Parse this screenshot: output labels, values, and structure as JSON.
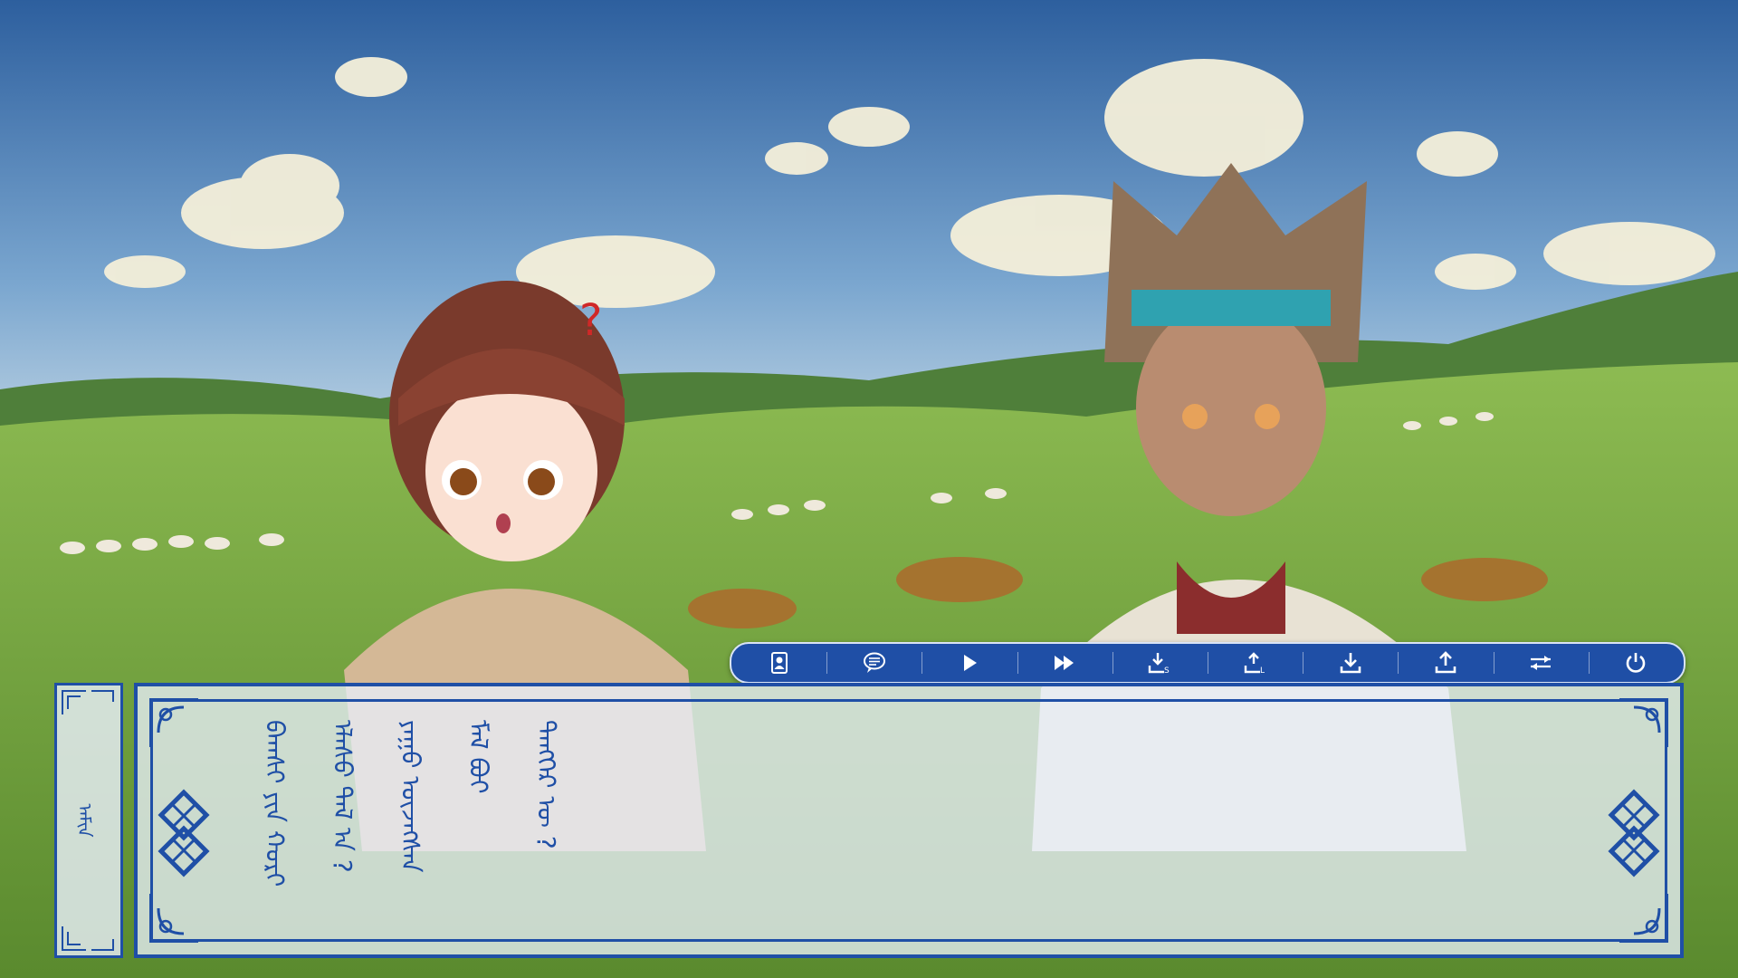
{
  "dialog": {
    "speaker": "ᠠᠮᠢᠨ",
    "lines": [
      "ᠪᠠᠭᠰᠢ ᠶᠢᠨ ᠬᠤᠷᠢ",
      "ᠡᠯᠡᠰᠦ ᠲᠠᠯ ᠠ ?",
      "ᠶᠠᠭᠤ ᠦᠵᠡᠭᠰᠡᠨ",
      "ᠮᠠᠯ ᠪᠣᠢ",
      "ᠲᠡᠩᠭᠡᠷ ᠦ ?"
    ]
  },
  "toolbar": {
    "buttons": [
      {
        "name": "profile-button",
        "icon": "profile-card-icon"
      },
      {
        "name": "log-button",
        "icon": "speech-bubble-icon"
      },
      {
        "name": "auto-play-button",
        "icon": "play-icon"
      },
      {
        "name": "skip-button",
        "icon": "fast-forward-icon"
      },
      {
        "name": "quick-save-button",
        "icon": "quick-save-icon"
      },
      {
        "name": "quick-load-button",
        "icon": "quick-load-icon"
      },
      {
        "name": "save-button",
        "icon": "download-icon"
      },
      {
        "name": "load-button",
        "icon": "upload-icon"
      },
      {
        "name": "settings-button",
        "icon": "sliders-icon"
      },
      {
        "name": "exit-button",
        "icon": "power-icon"
      }
    ]
  },
  "colors": {
    "ui_blue": "#1f4fa6",
    "panel": "#e8eef8",
    "sky": "#3b6fb0",
    "grass": "#7ba444"
  }
}
